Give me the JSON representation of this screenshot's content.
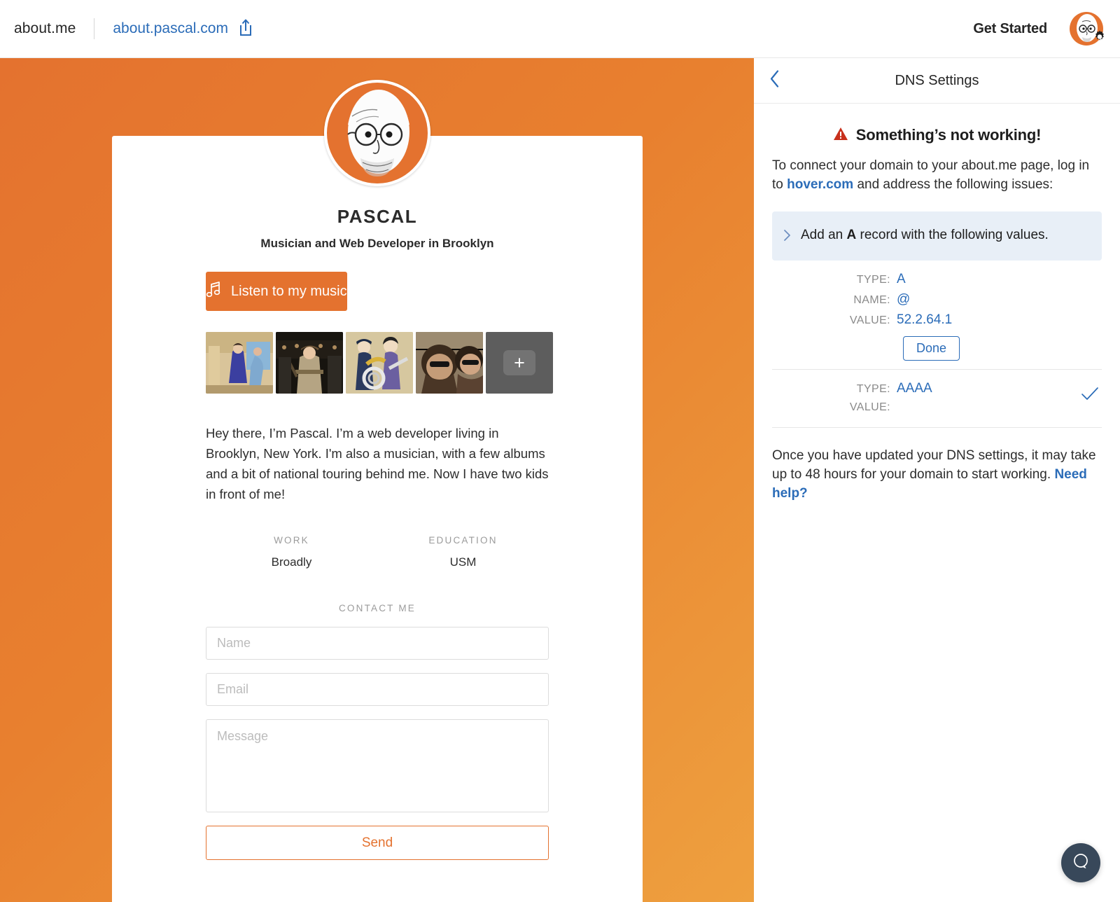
{
  "topbar": {
    "brand": "about.me",
    "domain": "about.pascal.com",
    "share_icon": "share-icon",
    "get_started": "Get Started",
    "avatar_icon": "user-avatar",
    "gear_icon": "gear-icon"
  },
  "profile": {
    "name": "PASCAL",
    "tagline": "Musician and Web Developer in Brooklyn",
    "music_button": "Listen to my music",
    "music_icon": "music-note-icon",
    "add_photo": "+",
    "bio": "Hey there, I’m Pascal. I’m a web developer living in Brooklyn, New York. I'm also a musician, with a few albums and a bit of national touring behind me. Now I have two kids in front of me!",
    "work_label": "WORK",
    "work_value": "Broadly",
    "education_label": "EDUCATION",
    "education_value": "USM",
    "contact_header": "CONTACT ME",
    "name_placeholder": "Name",
    "email_placeholder": "Email",
    "message_placeholder": "Message",
    "send_label": "Send",
    "gallery": [
      {
        "alt": "woman-in-blue-dress-photo"
      },
      {
        "alt": "man-with-hat-photo"
      },
      {
        "alt": "marching-band-illustration"
      },
      {
        "alt": "two-people-sunglasses-photo"
      }
    ]
  },
  "dns": {
    "back_icon": "chevron-left-icon",
    "title": "DNS Settings",
    "warning_icon": "warning-triangle-icon",
    "alert_title": "Something’s not working!",
    "intro_part1": "To connect your domain to your about.me page, log in to ",
    "intro_link": "hover.com",
    "intro_part2": " and address the following issues:",
    "issue_chevron": "chevron-right-icon",
    "issue_pre": "Add an ",
    "issue_bold": "A",
    "issue_post": " record with the following values.",
    "records": [
      {
        "type_label": "TYPE:",
        "type_value": "A",
        "name_label": "NAME:",
        "name_value": "@",
        "value_label": "VALUE:",
        "value_value": "52.2.64.1",
        "done_label": "Done"
      },
      {
        "type_label": "TYPE:",
        "type_value": "AAAA",
        "value_label": "VALUE:",
        "value_value": "",
        "check_icon": "checkmark-icon"
      }
    ],
    "outro_part1": "Once you have updated your DNS settings, it may take up to 48 hours for your domain to start working. ",
    "outro_link": "Need help?"
  },
  "chat": {
    "icon": "chat-bubble-icon"
  },
  "colors": {
    "brand_orange": "#e4722f",
    "link_blue": "#2b6cb8",
    "alert_red": "#c8301c",
    "info_bg": "#e8eff7",
    "chat_navy": "#38485a"
  }
}
